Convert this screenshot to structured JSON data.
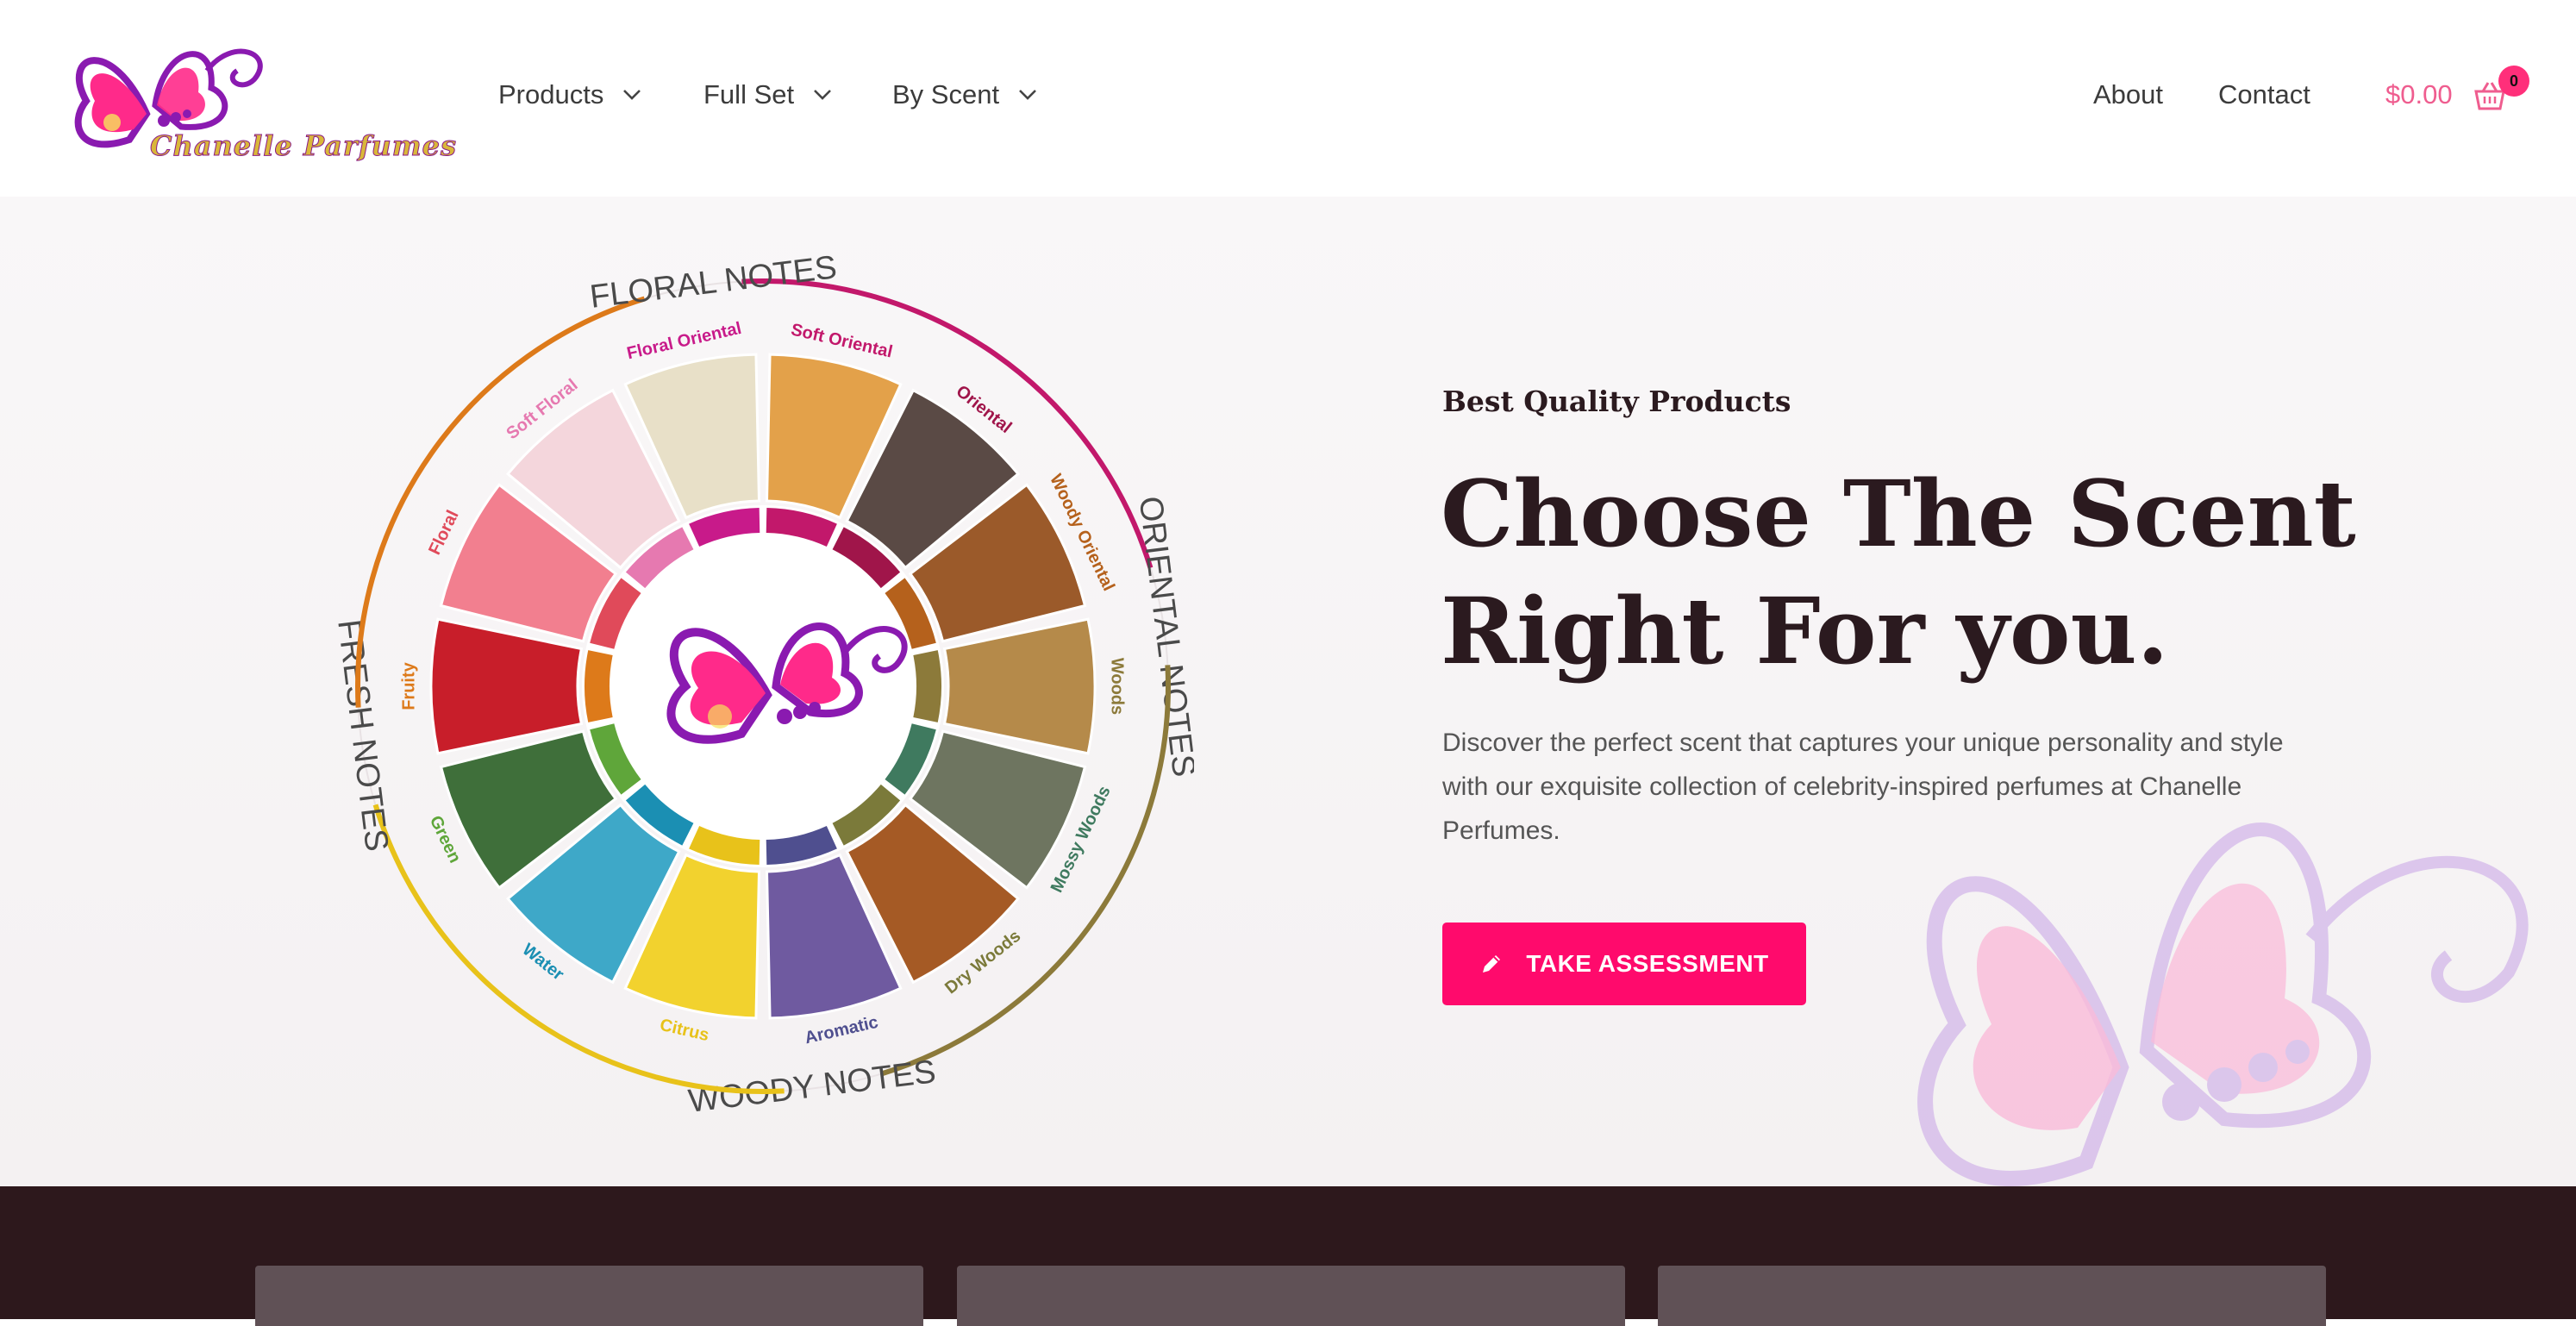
{
  "brand": {
    "name": "Chanelle Parfumes",
    "colors": {
      "pink": "#ff0a6c",
      "purple": "#8a1ab0",
      "gold": "#d9b73a",
      "dark": "#2d181c"
    }
  },
  "nav": {
    "items": [
      {
        "label": "Products",
        "has_dropdown": true
      },
      {
        "label": "Full Set",
        "has_dropdown": true
      },
      {
        "label": "By Scent",
        "has_dropdown": true
      }
    ],
    "right_links": [
      {
        "label": "About"
      },
      {
        "label": "Contact"
      }
    ],
    "cart": {
      "total": "$0.00",
      "count": "0",
      "icon": "basket-icon"
    }
  },
  "hero": {
    "eyebrow": "Best Quality Products",
    "headline_line1": "Choose The Scent",
    "headline_line2": "Right For you.",
    "description": "Discover the perfect scent that captures your unique personality and style with our exquisite collection of celebrity-inspired perfumes at Chanelle Perfumes.",
    "cta_label": "TAKE ASSESSMENT",
    "cta_icon": "pencil-icon"
  },
  "scent_wheel": {
    "families": [
      "ORIENTAL NOTES",
      "WOODY NOTES",
      "FRESH NOTES",
      "FLORAL NOTES"
    ],
    "segments": [
      {
        "label": "Soft Oriental",
        "color": "#c2186b",
        "photo": "#e3a14a"
      },
      {
        "label": "Oriental",
        "color": "#a0154a",
        "photo": "#5a4a45"
      },
      {
        "label": "Woody Oriental",
        "color": "#b5611c",
        "photo": "#9b5a2a"
      },
      {
        "label": "Woods",
        "color": "#8c7a3a",
        "photo": "#b58a4a"
      },
      {
        "label": "Mossy Woods",
        "color": "#3f7a5f",
        "photo": "#6e7560"
      },
      {
        "label": "Dry Woods",
        "color": "#7b7a3a",
        "photo": "#a55a25"
      },
      {
        "label": "Aromatic",
        "color": "#4f4f8f",
        "photo": "#6f5aa0"
      },
      {
        "label": "Citrus",
        "color": "#e8c21a",
        "photo": "#f2d22e"
      },
      {
        "label": "Water",
        "color": "#1b8fb3",
        "photo": "#3ea8c8"
      },
      {
        "label": "Green",
        "color": "#5fa63a",
        "photo": "#3f6f3a"
      },
      {
        "label": "Fruity",
        "color": "#dd7a1a",
        "photo": "#c81e2a"
      },
      {
        "label": "Floral",
        "color": "#e04a5a",
        "photo": "#f27f8f"
      },
      {
        "label": "Soft Floral",
        "color": "#e679b0",
        "photo": "#f4d6dc"
      },
      {
        "label": "Floral Oriental",
        "color": "#c81a8a",
        "photo": "#e8e0c8"
      }
    ]
  },
  "footer_cards": 3
}
